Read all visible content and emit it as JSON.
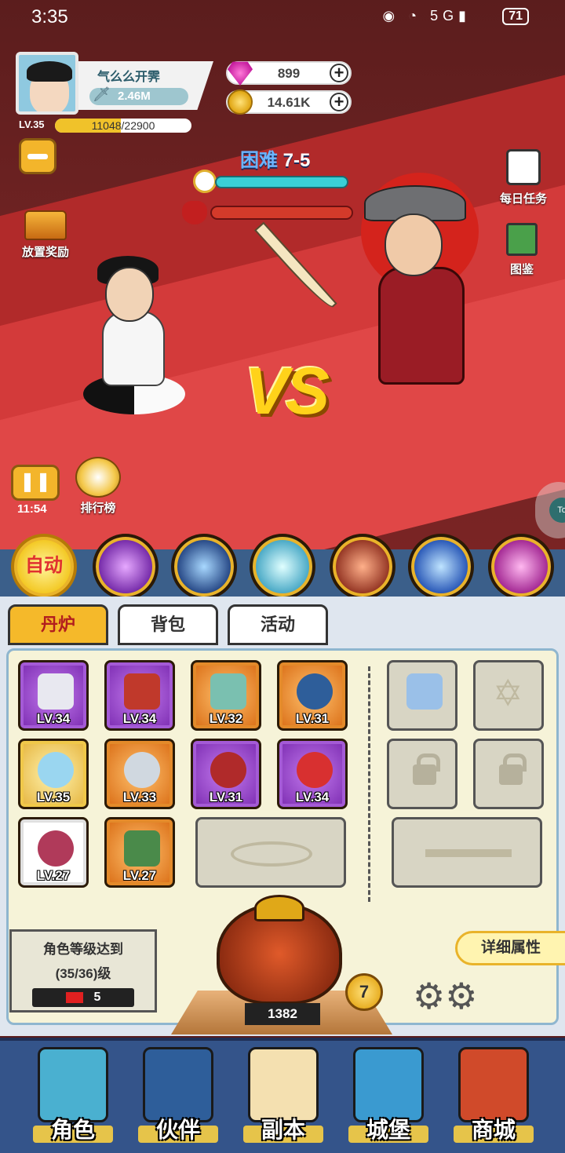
{
  "status_bar": {
    "time": "3:35",
    "signal": "5G",
    "battery": "71"
  },
  "player": {
    "name": "气么么开霁",
    "power": "2.46M",
    "level": "LV.35",
    "exp_current": "11048",
    "exp_max": "22900",
    "exp_fraction": 0.482
  },
  "resources": {
    "gems": "899",
    "coins": "14.61K"
  },
  "side_left": {
    "idle_reward": "放置奖励"
  },
  "side_right": {
    "daily_tasks": "每日任务",
    "codex": "图鉴"
  },
  "stage": {
    "difficulty": "困难",
    "number": "7-5"
  },
  "versus": "VS",
  "controls": {
    "timer": "11:54",
    "leaderboard": "排行榜",
    "float_label": "To"
  },
  "skills": {
    "auto": "自动"
  },
  "tabs": [
    "丹炉",
    "背包",
    "活动"
  ],
  "equipment": [
    {
      "level": "LV.34",
      "rarity": "purple",
      "name": "sword-icon"
    },
    {
      "level": "LV.34",
      "rarity": "purple",
      "name": "boots-icon"
    },
    {
      "level": "LV.32",
      "rarity": "orange",
      "name": "armor-icon"
    },
    {
      "level": "LV.31",
      "rarity": "orange",
      "name": "orb-icon"
    },
    {
      "level": "LV.35",
      "rarity": "gold",
      "name": "ring-icon"
    },
    {
      "level": "LV.33",
      "rarity": "orange",
      "name": "shield-icon"
    },
    {
      "level": "LV.31",
      "rarity": "purple",
      "name": "pendant-icon"
    },
    {
      "level": "LV.34",
      "rarity": "purple",
      "name": "gem-icon"
    },
    {
      "level": "LV.27",
      "rarity": "white",
      "name": "bracelet-icon"
    },
    {
      "level": "LV.27",
      "rarity": "orange",
      "name": "boots-green-icon"
    }
  ],
  "requirement": {
    "line1": "角色等级达到",
    "line2": "(35/36)级",
    "tickets": "5"
  },
  "detail_button": "详细属性",
  "furnace": {
    "count": "1382",
    "level": "7"
  },
  "nav": [
    "角色",
    "伙伴",
    "副本",
    "城堡",
    "商城"
  ],
  "colors": {
    "accent": "#f5b92a",
    "nav_bg": "#34548a",
    "battle_red": "#d33a3a"
  }
}
